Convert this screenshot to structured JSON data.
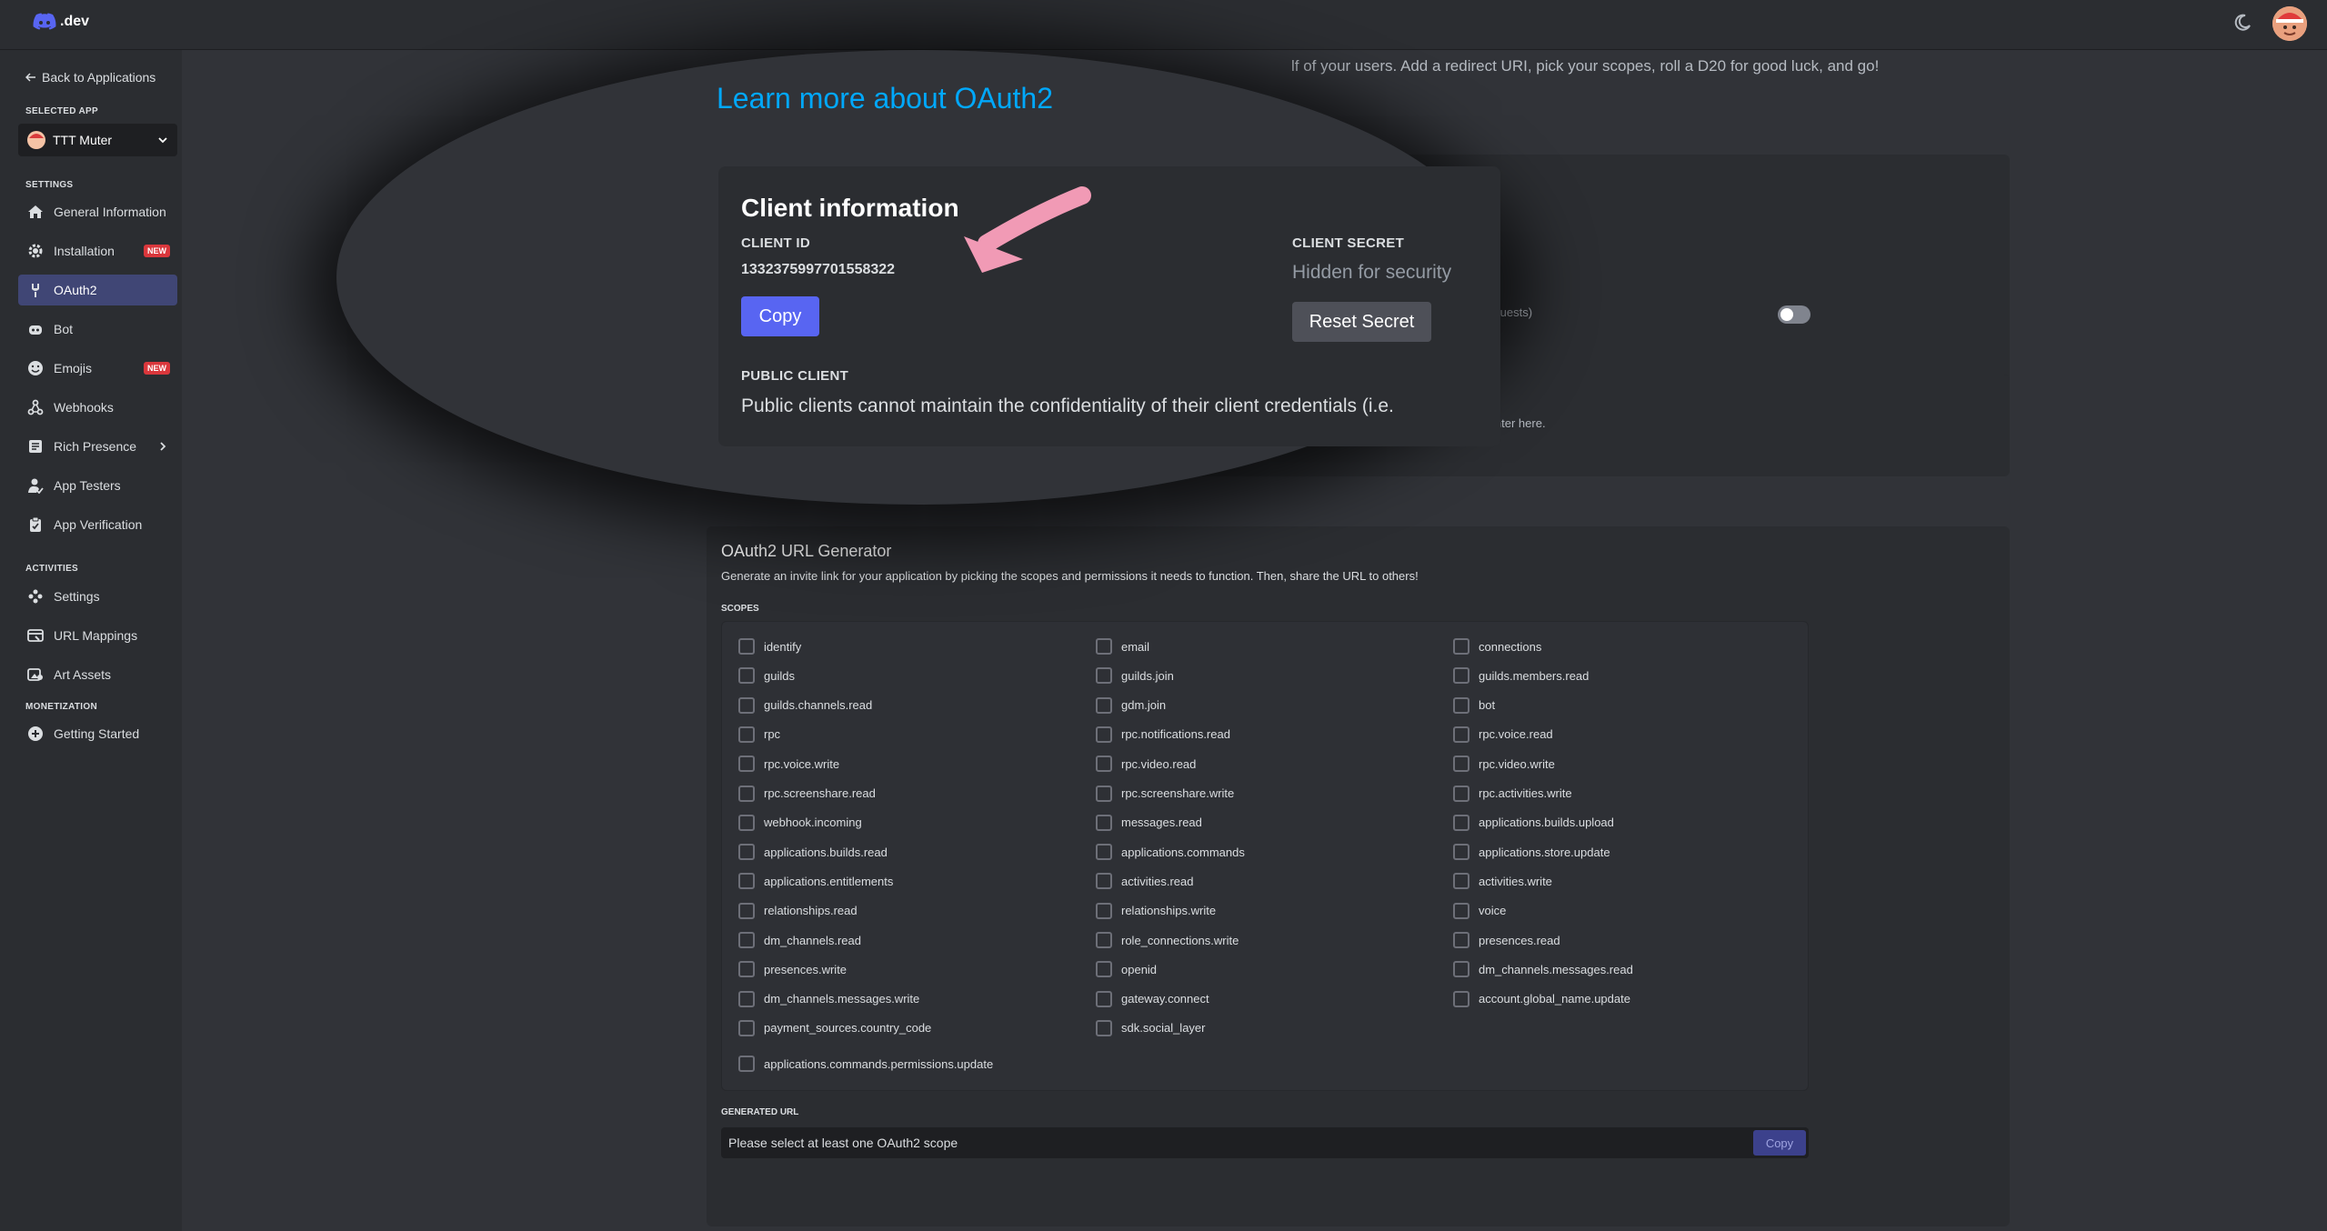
{
  "topbar": {
    "logo_text": ".dev"
  },
  "sidebar": {
    "back_label": "Back to Applications",
    "selected_app_heading": "SELECTED APP",
    "app_name": "TTT Muter",
    "settings_heading": "SETTINGS",
    "settings_items": [
      {
        "label": "General Information",
        "icon": "home-icon"
      },
      {
        "label": "Installation",
        "icon": "gear-icon",
        "badge": "NEW"
      },
      {
        "label": "OAuth2",
        "icon": "wrench-icon"
      },
      {
        "label": "Bot",
        "icon": "bot-icon"
      },
      {
        "label": "Emojis",
        "icon": "smiley-icon",
        "badge": "NEW"
      },
      {
        "label": "Webhooks",
        "icon": "webhook-icon"
      },
      {
        "label": "Rich Presence",
        "icon": "document-icon"
      },
      {
        "label": "App Testers",
        "icon": "user-icon"
      },
      {
        "label": "App Verification",
        "icon": "clipboard-check-icon"
      }
    ],
    "activities_heading": "ACTIVITIES",
    "activities_items": [
      {
        "label": "Settings",
        "icon": "controller-icon"
      },
      {
        "label": "URL Mappings",
        "icon": "link-icon"
      },
      {
        "label": "Art Assets",
        "icon": "image-icon"
      }
    ],
    "monetization_heading": "MONETIZATION",
    "monetization_items": [
      {
        "label": "Getting Started",
        "icon": "plus-circle-icon"
      }
    ]
  },
  "main": {
    "intro_tail": "lf of your users. Add a redirect URI, pick your scopes, roll a D20 for good luck, and go!",
    "learn_more": "Learn more about OAuth2",
    "bg_note_1": "e requests)",
    "bg_note_2": "atch one of the URIs you enter here."
  },
  "client_info": {
    "title": "Client information",
    "client_id_label": "CLIENT ID",
    "client_id": "1332375997701558322",
    "copy_label": "Copy",
    "client_secret_label": "CLIENT SECRET",
    "secret_placeholder": "Hidden for security",
    "reset_label": "Reset Secret",
    "public_client_label": "PUBLIC CLIENT",
    "public_client_text": "Public clients cannot maintain the confidentiality of their client credentials (i.e."
  },
  "url_generator": {
    "title": "OAuth2 URL Generator",
    "description": "Generate an invite link for your application by picking the scopes and permissions it needs to function. Then, share the URL to others!",
    "scopes_heading": "SCOPES",
    "scopes": [
      [
        "identify",
        "email",
        "connections"
      ],
      [
        "guilds",
        "guilds.join",
        "guilds.members.read"
      ],
      [
        "guilds.channels.read",
        "gdm.join",
        "bot"
      ],
      [
        "rpc",
        "rpc.notifications.read",
        "rpc.voice.read"
      ],
      [
        "rpc.voice.write",
        "rpc.video.read",
        "rpc.video.write"
      ],
      [
        "rpc.screenshare.read",
        "rpc.screenshare.write",
        "rpc.activities.write"
      ],
      [
        "webhook.incoming",
        "messages.read",
        "applications.builds.upload"
      ],
      [
        "applications.builds.read",
        "applications.commands",
        "applications.store.update"
      ],
      [
        "applications.entitlements",
        "activities.read",
        "activities.write"
      ],
      [
        "relationships.read",
        "relationships.write",
        "voice"
      ],
      [
        "dm_channels.read",
        "role_connections.write",
        "presences.read"
      ],
      [
        "presences.write",
        "openid",
        "dm_channels.messages.read"
      ],
      [
        "dm_channels.messages.write",
        "gateway.connect",
        "account.global_name.update"
      ],
      [
        "payment_sources.country_code",
        "sdk.social_layer",
        ""
      ]
    ],
    "last_scope": "applications.commands.permissions.update",
    "generated_url_heading": "GENERATED URL",
    "generated_url_placeholder": "Please select at least one OAuth2 scope",
    "copy_label": "Copy"
  },
  "colors": {
    "accent": "#5865f2",
    "link": "#00a8fc",
    "badge": "#da373c",
    "active_nav": "#404675"
  }
}
